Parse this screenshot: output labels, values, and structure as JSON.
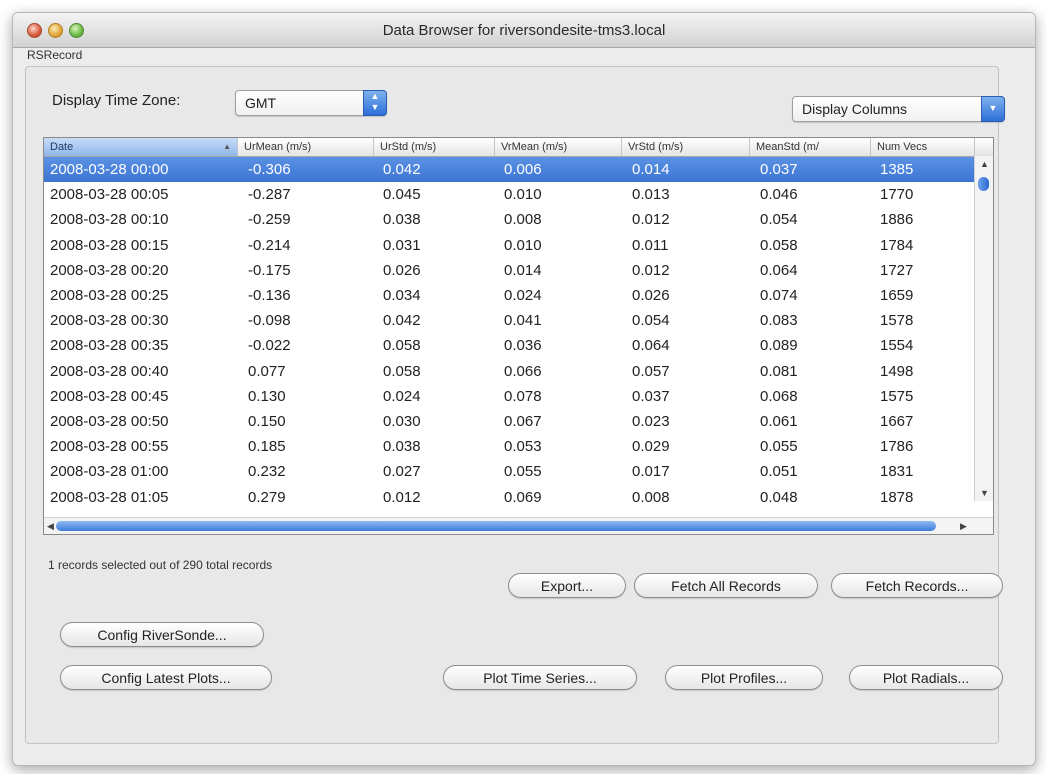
{
  "window": {
    "title": "Data Browser for riversondesite-tms3.local"
  },
  "section_label": "RSRecord",
  "timezone": {
    "label": "Display Time Zone:",
    "value": "GMT"
  },
  "display_columns": {
    "label": "Display Columns"
  },
  "table": {
    "columns": [
      "Date",
      "UrMean (m/s)",
      "UrStd (m/s)",
      "VrMean (m/s)",
      "VrStd (m/s)",
      "MeanStd (m/",
      "Num Vecs"
    ],
    "sorted_column": "Date",
    "rows": [
      [
        "2008-03-28 00:00",
        "-0.306",
        "0.042",
        "0.006",
        "0.014",
        "0.037",
        "1385"
      ],
      [
        "2008-03-28 00:05",
        "-0.287",
        "0.045",
        "0.010",
        "0.013",
        "0.046",
        "1770"
      ],
      [
        "2008-03-28 00:10",
        "-0.259",
        "0.038",
        "0.008",
        "0.012",
        "0.054",
        "1886"
      ],
      [
        "2008-03-28 00:15",
        "-0.214",
        "0.031",
        "0.010",
        "0.011",
        "0.058",
        "1784"
      ],
      [
        "2008-03-28 00:20",
        "-0.175",
        "0.026",
        "0.014",
        "0.012",
        "0.064",
        "1727"
      ],
      [
        "2008-03-28 00:25",
        "-0.136",
        "0.034",
        "0.024",
        "0.026",
        "0.074",
        "1659"
      ],
      [
        "2008-03-28 00:30",
        "-0.098",
        "0.042",
        "0.041",
        "0.054",
        "0.083",
        "1578"
      ],
      [
        "2008-03-28 00:35",
        "-0.022",
        "0.058",
        "0.036",
        "0.064",
        "0.089",
        "1554"
      ],
      [
        "2008-03-28 00:40",
        "0.077",
        "0.058",
        "0.066",
        "0.057",
        "0.081",
        "1498"
      ],
      [
        "2008-03-28 00:45",
        "0.130",
        "0.024",
        "0.078",
        "0.037",
        "0.068",
        "1575"
      ],
      [
        "2008-03-28 00:50",
        "0.150",
        "0.030",
        "0.067",
        "0.023",
        "0.061",
        "1667"
      ],
      [
        "2008-03-28 00:55",
        "0.185",
        "0.038",
        "0.053",
        "0.029",
        "0.055",
        "1786"
      ],
      [
        "2008-03-28 01:00",
        "0.232",
        "0.027",
        "0.055",
        "0.017",
        "0.051",
        "1831"
      ],
      [
        "2008-03-28 01:05",
        "0.279",
        "0.012",
        "0.069",
        "0.008",
        "0.048",
        "1878"
      ]
    ],
    "selected_row": 0
  },
  "status_text": "1 records selected out of 290 total records",
  "buttons": {
    "export": "Export...",
    "fetch_all": "Fetch All Records",
    "fetch_records": "Fetch Records...",
    "config_riversonde": "Config RiverSonde...",
    "config_latest_plots": "Config Latest Plots...",
    "plot_time_series": "Plot Time Series...",
    "plot_profiles": "Plot Profiles...",
    "plot_radials": "Plot Radials..."
  },
  "colors": {
    "selection": "#3c74d3",
    "accent": "#2d6fd8"
  }
}
